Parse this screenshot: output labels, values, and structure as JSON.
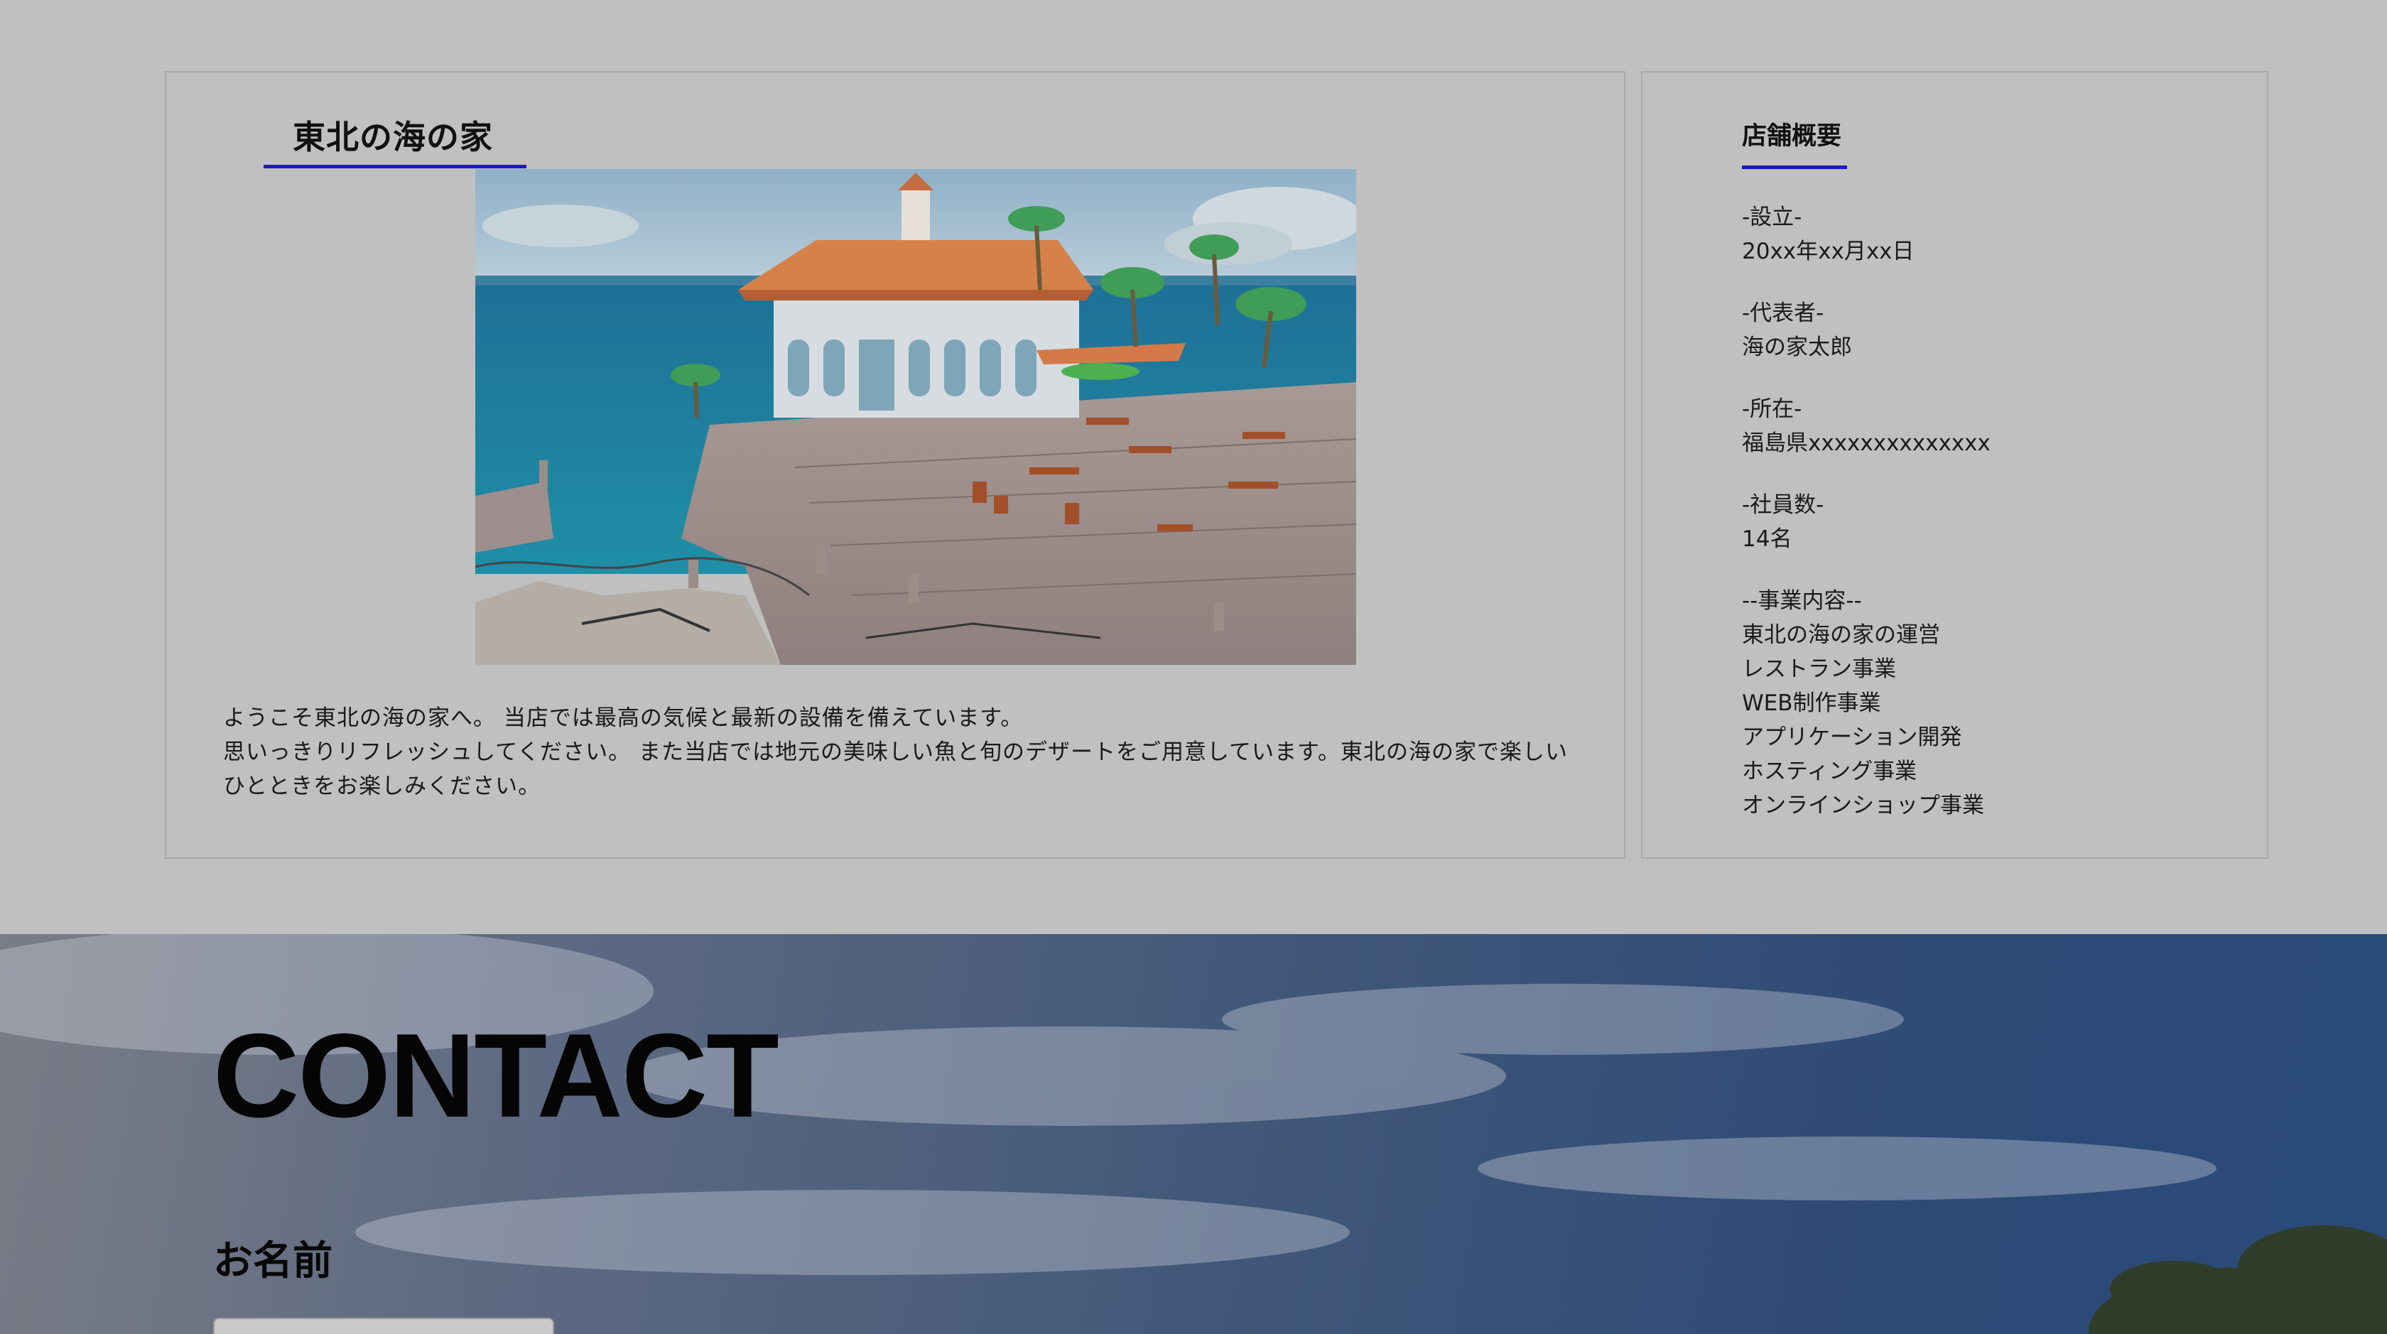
{
  "main": {
    "title": "東北の海の家",
    "image_alt": "海の家の風景",
    "intro_lines": [
      "ようこそ東北の海の家へ。 当店では最高の気候と最新の設備を備えています。",
      "思いっきりリフレッシュしてください。 また当店では地元の美味しい魚と旬のデザートをご用意しています。東北の海の家で楽しい",
      "ひとときをお楽しみください。"
    ]
  },
  "sidebar": {
    "title": "店舗概要",
    "groups": [
      {
        "label": "-設立-",
        "values": [
          "20xx年xx月xx日"
        ]
      },
      {
        "label": "-代表者-",
        "values": [
          "海の家太郎"
        ]
      },
      {
        "label": "-所在-",
        "values": [
          "福島県xxxxxxxxxxxxxx"
        ]
      },
      {
        "label": "-社員数-",
        "values": [
          "14名"
        ]
      },
      {
        "label": "--事業内容--",
        "values": [
          "東北の海の家の運営",
          "レストラン事業",
          "WEB制作事業",
          "アプリケーション開発",
          "ホスティング事業",
          "オンラインショップ事業"
        ]
      }
    ]
  },
  "contact": {
    "title": "CONTACT",
    "name_label": "お名前",
    "name_value": ""
  },
  "colors": {
    "overlay_gray": "#c0c0c0",
    "underline_blue": "#1a1ab8",
    "panel_border": "#a9a9a9"
  }
}
